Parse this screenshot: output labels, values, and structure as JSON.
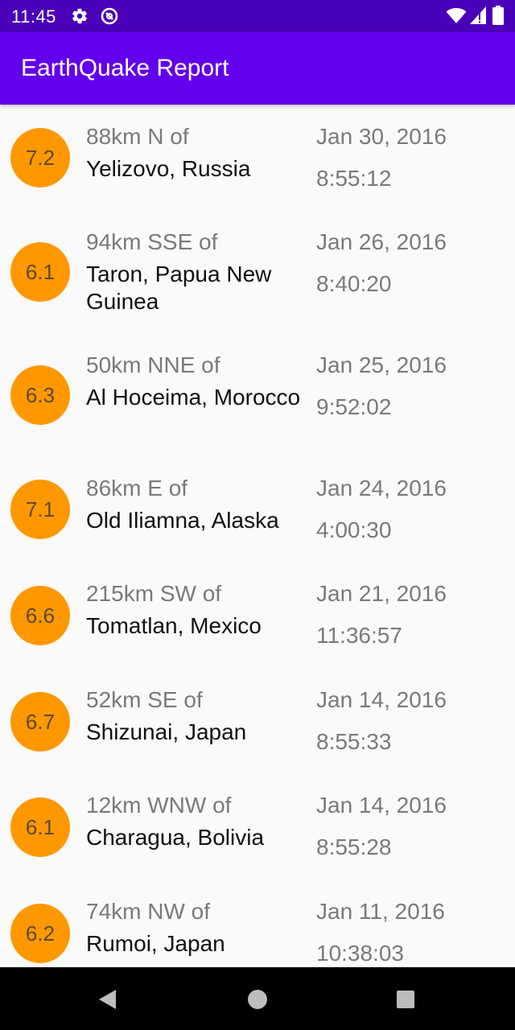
{
  "status_bar": {
    "time": "11:45",
    "icons": [
      "gear-icon",
      "sync-icon",
      "wifi-icon",
      "signal-icon",
      "battery-icon"
    ]
  },
  "app_bar": {
    "title": "EarthQuake Report",
    "color": "#6200ee"
  },
  "colors": {
    "status_bar": "#4a00b8",
    "magnitude_circle": "#ff9800",
    "secondary_text": "#7a7a7a",
    "primary_text": "#111111"
  },
  "earthquakes": [
    {
      "magnitude": "7.2",
      "offset": "88km N of",
      "place": "Yelizovo, Russia",
      "date": "Jan 30, 2016",
      "time": "8:55:12"
    },
    {
      "magnitude": "6.1",
      "offset": "94km SSE of",
      "place": "Taron, Papua New Guinea",
      "date": "Jan 26, 2016",
      "time": "8:40:20"
    },
    {
      "magnitude": "6.3",
      "offset": "50km NNE of",
      "place": "Al Hoceima, Morocco",
      "date": "Jan 25, 2016",
      "time": "9:52:02"
    },
    {
      "magnitude": "7.1",
      "offset": "86km E of",
      "place": "Old Iliamna, Alaska",
      "date": "Jan 24, 2016",
      "time": "4:00:30"
    },
    {
      "magnitude": "6.6",
      "offset": "215km SW of",
      "place": "Tomatlan, Mexico",
      "date": "Jan 21, 2016",
      "time": "11:36:57"
    },
    {
      "magnitude": "6.7",
      "offset": "52km SE of",
      "place": "Shizunai, Japan",
      "date": "Jan 14, 2016",
      "time": "8:55:33"
    },
    {
      "magnitude": "6.1",
      "offset": "12km WNW of",
      "place": "Charagua, Bolivia",
      "date": "Jan 14, 2016",
      "time": "8:55:28"
    },
    {
      "magnitude": "6.2",
      "offset": "74km NW of",
      "place": "Rumoi, Japan",
      "date": "Jan 11, 2016",
      "time": "10:38:03"
    }
  ],
  "nav_bar": {
    "icons": [
      "back-icon",
      "home-icon",
      "recents-icon"
    ]
  }
}
